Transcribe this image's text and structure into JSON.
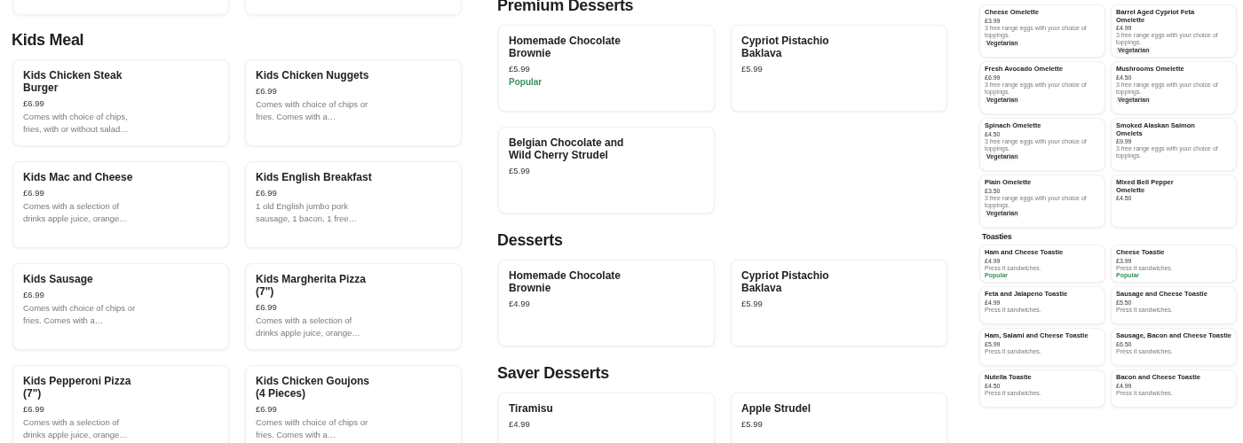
{
  "panels": [
    {
      "sections": [
        {
          "heading": "Kids Meal",
          "items": [
            {
              "name": "Kids Chicken Steak Burger",
              "price": "£6.99",
              "description": "Comes with choice of chips, fries, with or without salad…"
            },
            {
              "name": "Kids Chicken Nuggets",
              "price": "£6.99",
              "description": "Comes with choice of chips or fries. Comes with a…"
            },
            {
              "name": "Kids Mac and Cheese",
              "price": "£6.99",
              "description": "Comes with a selection of drinks apple juice, orange…"
            },
            {
              "name": "Kids English Breakfast",
              "price": "£6.99",
              "description": "1 old English jumbo pork sausage, 1 bacon, 1 free…"
            },
            {
              "name": "Kids Sausage",
              "price": "£6.99",
              "description": "Comes with choice of chips or fries. Comes with a…"
            },
            {
              "name": "Kids Margherita Pizza (7\")",
              "price": "£6.99",
              "description": "Comes with a selection of drinks apple juice, orange…"
            },
            {
              "name": "Kids Pepperoni Pizza (7\")",
              "price": "£6.99",
              "description": "Comes with a selection of drinks apple juice, orange…"
            },
            {
              "name": "Kids Chicken Goujons (4 Pieces)",
              "price": "£6.99",
              "description": "Comes with choice of chips or fries. Comes with a…"
            }
          ]
        }
      ]
    },
    {
      "sections": [
        {
          "heading": "Premium Desserts",
          "items": [
            {
              "name": "Homemade Chocolate Brownie",
              "price": "£5.99",
              "tag": {
                "kind": "popular",
                "text": "Popular"
              }
            },
            {
              "name": "Cypriot Pistachio Baklava",
              "price": "£5.99"
            },
            {
              "name": "Belgian Chocolate and Wild Cherry Strudel",
              "price": "£5.99"
            }
          ]
        },
        {
          "heading": "Desserts",
          "items": [
            {
              "name": "Homemade Chocolate Brownie",
              "price": "£4.99"
            },
            {
              "name": "Cypriot Pistachio Baklava",
              "price": "£5.99"
            }
          ]
        },
        {
          "heading": "Saver Desserts",
          "items": [
            {
              "name": "Tiramisu",
              "price": "£4.99"
            },
            {
              "name": "Apple Strudel",
              "price": "£5.99"
            }
          ]
        }
      ]
    },
    {
      "sections": [
        {
          "items": [
            {
              "name": "Cheese Omelette",
              "price": "£3.99",
              "description": "3 free range eggs with your choice of toppings.",
              "tag": {
                "kind": "vegetarian",
                "text": "Vegetarian"
              }
            },
            {
              "name": "Barrel Aged Cypriot Feta Omelette",
              "price": "£4.99",
              "description": "3 free range eggs with your choice of toppings.",
              "tag": {
                "kind": "vegetarian",
                "text": "Vegetarian"
              }
            },
            {
              "name": "Fresh Avocado Omelette",
              "price": "£6.99",
              "description": "3 free range eggs with your choice of toppings.",
              "tag": {
                "kind": "vegetarian",
                "text": "Vegetarian"
              }
            },
            {
              "name": "Mushrooms Omelette",
              "price": "£4.50",
              "description": "3 free range eggs with your choice of toppings.",
              "tag": {
                "kind": "vegetarian",
                "text": "Vegetarian"
              }
            },
            {
              "name": "Spinach Omelette",
              "price": "£4.50",
              "description": "3 free range eggs with your choice of toppings.",
              "tag": {
                "kind": "vegetarian",
                "text": "Vegetarian"
              }
            },
            {
              "name": "Smoked Alaskan Salmon Omelets",
              "price": "£9.99",
              "description": "3 free range eggs with your choice of toppings."
            },
            {
              "name": "Plain Omelette",
              "price": "£3.50",
              "description": "3 free range eggs with your choice of toppings.",
              "tag": {
                "kind": "vegetarian",
                "text": "Vegetarian"
              }
            },
            {
              "name": "Mixed Bell Pepper Omelette",
              "price": "£4.50"
            }
          ]
        },
        {
          "heading": "Toasties",
          "items": [
            {
              "name": "Ham and Cheese Toastie",
              "price": "£4.99",
              "description": "Press it sandwiches.",
              "tag": {
                "kind": "popular",
                "text": "Popular"
              }
            },
            {
              "name": "Cheese Toastie",
              "price": "£3.99",
              "description": "Press it sandwiches.",
              "tag": {
                "kind": "popular",
                "text": "Popular"
              }
            },
            {
              "name": "Feta and Jalapeno Toastie",
              "price": "£4.99",
              "description": "Press it sandwiches."
            },
            {
              "name": "Sausage and Cheese Toastie",
              "price": "£5.50",
              "description": "Press it sandwiches."
            },
            {
              "name": "Ham, Salami and Cheese Toastie",
              "price": "£5.99",
              "description": "Press it sandwiches."
            },
            {
              "name": "Sausage, Bacon and Cheese Toastie",
              "price": "£6.50",
              "description": "Press it sandwiches."
            },
            {
              "name": "Nutella Toastie",
              "price": "£4.50",
              "description": "Press it sandwiches."
            },
            {
              "name": "Bacon and Cheese Toastie",
              "price": "£4.99",
              "description": "Press it sandwiches."
            }
          ]
        }
      ]
    }
  ]
}
